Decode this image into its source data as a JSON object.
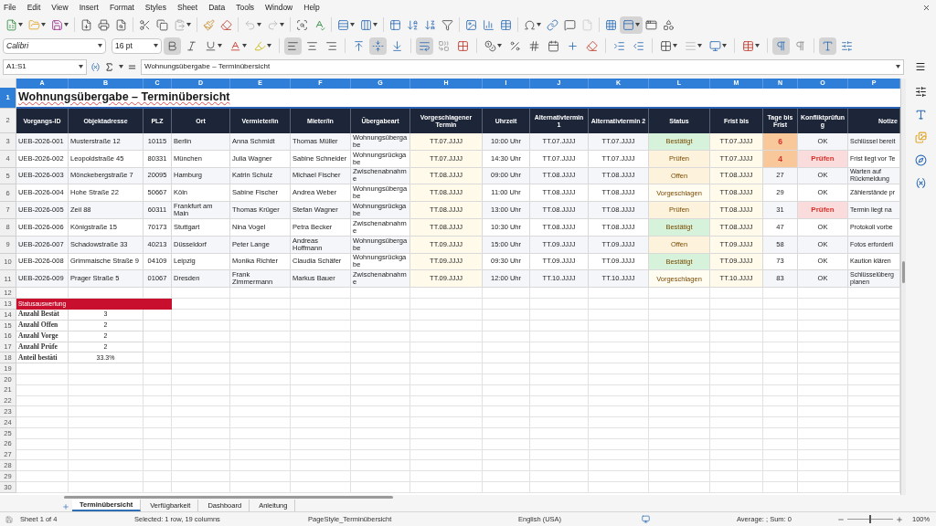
{
  "menu": [
    "File",
    "Edit",
    "View",
    "Insert",
    "Format",
    "Styles",
    "Sheet",
    "Data",
    "Tools",
    "Window",
    "Help"
  ],
  "format_toolbar": {
    "font_name": "Calibri",
    "font_size": "16 pt",
    "bold_on": true,
    "italic_on": false,
    "underline_on": false,
    "align_left_on": true,
    "align_center_on": false,
    "align_right_on": false,
    "align_top_on": false,
    "align_middle_on": true,
    "align_bottom_on": false,
    "wrap_on": true,
    "ltr_on": true,
    "rtl_on": false,
    "vertical_text_on": true
  },
  "formula_bar": {
    "name_box": "A1:S1",
    "content": "Wohnungsübergabe – Terminübersicht"
  },
  "column_letters": [
    {
      "label": "A",
      "selected": true
    },
    {
      "label": "B",
      "selected": true
    },
    {
      "label": "C",
      "selected": true
    },
    {
      "label": "D",
      "selected": true
    },
    {
      "label": "E",
      "selected": true
    },
    {
      "label": "F",
      "selected": true
    },
    {
      "label": "G",
      "selected": true
    },
    {
      "label": "H",
      "selected": true
    },
    {
      "label": "I",
      "selected": true
    },
    {
      "label": "J",
      "selected": true
    },
    {
      "label": "K",
      "selected": true
    },
    {
      "label": "L",
      "selected": true
    },
    {
      "label": "M",
      "selected": true
    },
    {
      "label": "N",
      "selected": true
    },
    {
      "label": "O",
      "selected": true
    },
    {
      "label": "P",
      "selected": true
    }
  ],
  "rows": [
    {
      "kind": "title",
      "number": "1",
      "selected": true,
      "text": "Wohnungsübergabe – Terminübersicht"
    },
    {
      "kind": "header",
      "number": "2",
      "selected": false,
      "cells": [
        "Vorgangs-ID",
        "Objektadresse",
        "PLZ",
        "Ort",
        "Vermieter/in",
        "Mieter/in",
        "Übergabeart",
        "Vorgeschlagener Termin",
        "Uhrzeit",
        "Alternativtermin 1",
        "Alternativtermin 2",
        "Status",
        "Frist bis",
        "Tage bis Frist",
        "Konfliktprüfung",
        "Notize"
      ]
    },
    {
      "kind": "data",
      "number": "3",
      "selected": false,
      "cells": [
        "UEB-2026-001",
        "Musterstraße 12",
        "10115",
        "Berlin",
        "Anna Schmidt",
        "Thomas Müller",
        "Wohnungsübergabe",
        "TT.07.JJJJ",
        "10:00 Uhr",
        "TT.07.JJJJ",
        "TT.07.JJJJ"
      ],
      "status": {
        "text": "Bestätigt",
        "color": "#d6f2da"
      },
      "frist": "TT.07.JJJJ",
      "tage": {
        "text": "6",
        "warning": true
      },
      "konflikt": {
        "text": "OK",
        "warning": false
      },
      "notiz": "Schlüssel bereit"
    },
    {
      "kind": "data",
      "number": "4",
      "selected": false,
      "cells": [
        "UEB-2026-002",
        "Leopoldstraße 45",
        "80331",
        "München",
        "Julia Wagner",
        "Sabine Schneider",
        "Wohnungsrückgabe",
        "TT.07.JJJJ",
        "14:30 Uhr",
        "TT.07.JJJJ",
        "TT.07.JJJJ"
      ],
      "status": {
        "text": "Prüfen",
        "color": "#fdf3dc"
      },
      "frist": "TT.07.JJJJ",
      "tage": {
        "text": "4",
        "warning": true
      },
      "konflikt": {
        "text": "Prüfen",
        "warning": true
      },
      "notiz": "Frist liegt vor Te"
    },
    {
      "kind": "data",
      "number": "5",
      "selected": false,
      "cells": [
        "UEB-2026-003",
        "Mönckebergstraße 7",
        "20095",
        "Hamburg",
        "Katrin Schulz",
        "Michael Fischer",
        "Zwischenabnahme",
        "TT.08.JJJJ",
        "09:00 Uhr",
        "TT.08.JJJJ",
        "TT.08.JJJJ"
      ],
      "status": {
        "text": "Offen",
        "color": "#fdf3dc"
      },
      "frist": "TT.08.JJJJ",
      "tage": {
        "text": "27",
        "warning": false
      },
      "konflikt": {
        "text": "OK",
        "warning": false
      },
      "notiz": "Warten auf Rückmeldung"
    },
    {
      "kind": "data",
      "number": "6",
      "selected": false,
      "cells": [
        "UEB-2026-004",
        "Hohe Straße 22",
        "50667",
        "Köln",
        "Sabine Fischer",
        "Andrea Weber",
        "Wohnungsübergabe",
        "TT.08.JJJJ",
        "11:00 Uhr",
        "TT.08.JJJJ",
        "TT.08.JJJJ"
      ],
      "status": {
        "text": "Vorgeschlagen",
        "color": "#fffcf2"
      },
      "frist": "TT.08.JJJJ",
      "tage": {
        "text": "29",
        "warning": false
      },
      "konflikt": {
        "text": "OK",
        "warning": false
      },
      "notiz": "Zählerstände pr"
    },
    {
      "kind": "data",
      "number": "7",
      "selected": false,
      "cells": [
        "UEB-2026-005",
        "Zeil 88",
        "60311",
        "Frankfurt am Main",
        "Thomas Krüger",
        "Stefan Wagner",
        "Wohnungsrückgabe",
        "TT.08.JJJJ",
        "13:00 Uhr",
        "TT.08.JJJJ",
        "TT.08.JJJJ"
      ],
      "status": {
        "text": "Prüfen",
        "color": "#fdf3dc"
      },
      "frist": "TT.08.JJJJ",
      "tage": {
        "text": "31",
        "warning": false
      },
      "konflikt": {
        "text": "Prüfen",
        "warning": true
      },
      "notiz": "Termin liegt na"
    },
    {
      "kind": "data",
      "number": "8",
      "selected": false,
      "cells": [
        "UEB-2026-006",
        "Königstraße 15",
        "70173",
        "Stuttgart",
        "Nina Vogel",
        "Petra Becker",
        "Zwischenabnahme",
        "TT.08.JJJJ",
        "10:30 Uhr",
        "TT.08.JJJJ",
        "TT.08.JJJJ"
      ],
      "status": {
        "text": "Bestätigt",
        "color": "#d6f2da"
      },
      "frist": "TT.08.JJJJ",
      "tage": {
        "text": "47",
        "warning": false
      },
      "konflikt": {
        "text": "OK",
        "warning": false
      },
      "notiz": "Protokoll vorbe"
    },
    {
      "kind": "data",
      "number": "9",
      "selected": false,
      "cells": [
        "UEB-2026-007",
        "Schadowstraße 33",
        "40213",
        "Düsseldorf",
        "Peter Lange",
        "Andreas Hoffmann",
        "Wohnungsübergabe",
        "TT.09.JJJJ",
        "15:00 Uhr",
        "TT.09.JJJJ",
        "TT.09.JJJJ"
      ],
      "status": {
        "text": "Offen",
        "color": "#fdf3dc"
      },
      "frist": "TT.09.JJJJ",
      "tage": {
        "text": "58",
        "warning": false
      },
      "konflikt": {
        "text": "OK",
        "warning": false
      },
      "notiz": "Fotos erforderli"
    },
    {
      "kind": "data",
      "number": "10",
      "selected": false,
      "cells": [
        "UEB-2026-008",
        "Grimmaische Straße 9",
        "04109",
        "Leipzig",
        "Monika Richter",
        "Claudia Schäfer",
        "Wohnungsrückgabe",
        "TT.09.JJJJ",
        "09:30 Uhr",
        "TT.09.JJJJ",
        "TT.09.JJJJ"
      ],
      "status": {
        "text": "Bestätigt",
        "color": "#d6f2da"
      },
      "frist": "TT.09.JJJJ",
      "tage": {
        "text": "73",
        "warning": false
      },
      "konflikt": {
        "text": "OK",
        "warning": false
      },
      "notiz": "Kaution klären"
    },
    {
      "kind": "data",
      "number": "11",
      "selected": false,
      "cells": [
        "UEB-2026-009",
        "Prager Straße 5",
        "01067",
        "Dresden",
        "Frank Zimmermann",
        "Markus Bauer",
        "Zwischenabnahme",
        "TT.09.JJJJ",
        "12:00 Uhr",
        "TT.10.JJJJ",
        "TT.10.JJJJ"
      ],
      "status": {
        "text": "Vorgeschlagen",
        "color": "#fffcf2"
      },
      "frist": "TT.10.JJJJ",
      "tage": {
        "text": "83",
        "warning": false
      },
      "konflikt": {
        "text": "OK",
        "warning": false
      },
      "notiz": "Schlüsselüberg planen"
    },
    {
      "kind": "empty",
      "number": "12",
      "selected": false
    },
    {
      "kind": "section",
      "number": "13",
      "selected": false,
      "text": "Statusauswertung"
    },
    {
      "kind": "summary",
      "number": "14",
      "selected": false,
      "label": "Anzahl Bestät",
      "value": "3"
    },
    {
      "kind": "summary",
      "number": "15",
      "selected": false,
      "label": "Anzahl Offen",
      "value": "2"
    },
    {
      "kind": "summary",
      "number": "16",
      "selected": false,
      "label": "Anzahl Vorge",
      "value": "2"
    },
    {
      "kind": "summary",
      "number": "17",
      "selected": false,
      "label": "Anzahl Prüfe",
      "value": "2"
    },
    {
      "kind": "summary",
      "number": "18",
      "selected": false,
      "label": "Anteil bestäti",
      "value": "33.3%"
    },
    {
      "kind": "empty",
      "number": "19",
      "selected": false
    },
    {
      "kind": "empty",
      "number": "20",
      "selected": false
    },
    {
      "kind": "empty",
      "number": "21",
      "selected": false
    },
    {
      "kind": "empty",
      "number": "22",
      "selected": false
    },
    {
      "kind": "empty",
      "number": "23",
      "selected": false
    },
    {
      "kind": "empty",
      "number": "24",
      "selected": false
    },
    {
      "kind": "empty",
      "number": "25",
      "selected": false
    },
    {
      "kind": "empty",
      "number": "26",
      "selected": false
    },
    {
      "kind": "empty",
      "number": "27",
      "selected": false
    },
    {
      "kind": "empty",
      "number": "28",
      "selected": false
    },
    {
      "kind": "empty",
      "number": "29",
      "selected": false
    },
    {
      "kind": "empty",
      "number": "30",
      "selected": false
    }
  ],
  "sheet_tabs": [
    {
      "label": "Terminübersicht",
      "selected": true
    },
    {
      "label": "Verfügbarkeit",
      "selected": false
    },
    {
      "label": "Dashboard",
      "selected": false
    },
    {
      "label": "Anleitung",
      "selected": false
    }
  ],
  "status_bar": {
    "sheet": "Sheet 1 of 4",
    "selection": "Selected: 1 row, 19 columns",
    "page_style": "PageStyle_Terminübersicht",
    "language": "English (USA)",
    "sum": "Average: ; Sum: 0",
    "zoom": {
      "level": 0.5,
      "reading": "100%"
    }
  }
}
